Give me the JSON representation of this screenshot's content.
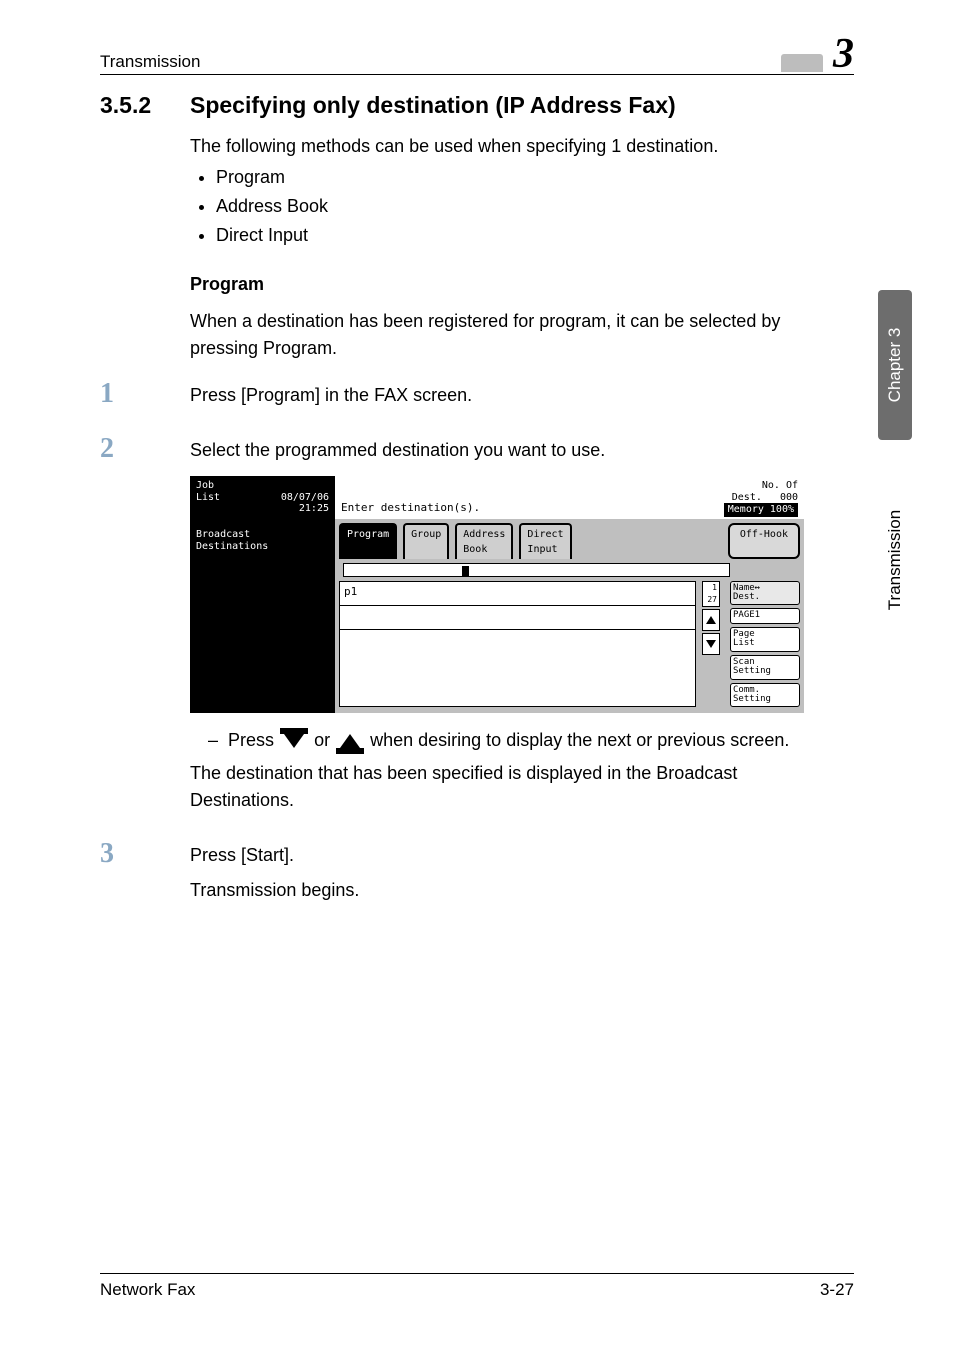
{
  "header": {
    "section_label": "Transmission",
    "chapter_number": "3"
  },
  "side": {
    "chapter_tab": "Chapter 3",
    "section_tab": "Transmission"
  },
  "heading": {
    "number": "3.5.2",
    "title": "Specifying only destination (IP Address Fax)"
  },
  "intro": "The following methods can be used when specifying 1 destination.",
  "methods": [
    "Program",
    "Address Book",
    "Direct Input"
  ],
  "program": {
    "label": "Program",
    "desc": "When a destination has been registered for program, it can be selected by pressing Program."
  },
  "steps": {
    "s1": "Press [Program] in the FAX screen.",
    "s2": "Select the programmed destination you want to use.",
    "s2_sub_pre": "Press",
    "s2_sub_mid": "or",
    "s2_sub_post": "when desiring to display the next or previous screen.",
    "s2_note": "The destination that has been specified is displayed in the Broadcast Destinations.",
    "s3_a": "Press [Start].",
    "s3_b": "Transmission begins."
  },
  "panel": {
    "job_line1": "Job",
    "job_line2": "List",
    "date": "08/07/06",
    "time": "21:25",
    "title": "Enter destination(s).",
    "no_of_dest_label": "No. Of\nDest.",
    "no_of_dest_value": "000",
    "memory_label": "Memory 100%",
    "side_line1": "Broadcast",
    "side_line2": "Destinations",
    "tabs": {
      "program": "Program",
      "group": "Group",
      "address_book": "Address\nBook",
      "direct_input": "Direct\nInput",
      "off_hook": "Off-Hook"
    },
    "entry": "p1",
    "fraction": "1\n27",
    "right": {
      "name_dest": "Name↔\nDest.",
      "page1": "PAGE1",
      "page_list": "Page\nList",
      "scan_setting": "Scan\nSetting",
      "comm_setting": "Comm.\nSetting"
    }
  },
  "footer": {
    "left": "Network Fax",
    "right": "3-27"
  }
}
